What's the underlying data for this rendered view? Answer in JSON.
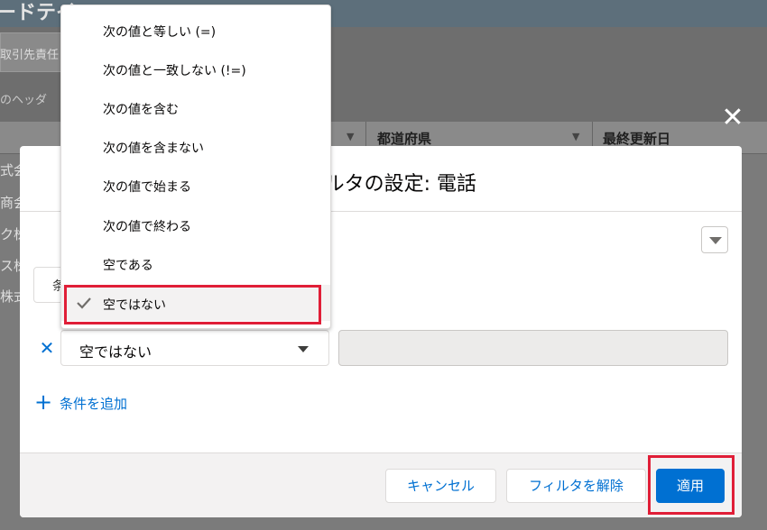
{
  "background": {
    "title": "ードテイ…",
    "column_headers": [
      "都道府県",
      "最終更新日"
    ],
    "toolbar_button": "取引先責任",
    "hint": "のヘッダ",
    "rows": [
      "式会",
      "商会",
      "ク株",
      "ス株",
      "株式"
    ],
    "partial_button": "条"
  },
  "modal": {
    "title": "フィルタの設定: 電話",
    "operator_value": "空ではない",
    "add_condition_label": "条件を追加",
    "buttons": {
      "cancel": "キャンセル",
      "clear": "フィルタを解除",
      "apply": "適用"
    }
  },
  "dropdown": {
    "items": [
      {
        "label": "次の値と等しい (=)"
      },
      {
        "label": "次の値と一致しない (!=)"
      },
      {
        "label": "次の値を含む"
      },
      {
        "label": "次の値を含まない"
      },
      {
        "label": "次の値で始まる"
      },
      {
        "label": "次の値で終わる"
      },
      {
        "label": "空である"
      },
      {
        "label": "空ではない",
        "selected": true
      }
    ]
  },
  "colors": {
    "brand": "#0070d2",
    "highlight": "#e01e37",
    "overlay": "#7b7b7b"
  },
  "icons": [
    "close-icon",
    "chevron-down-icon",
    "remove-icon",
    "plus-icon",
    "check-icon"
  ]
}
